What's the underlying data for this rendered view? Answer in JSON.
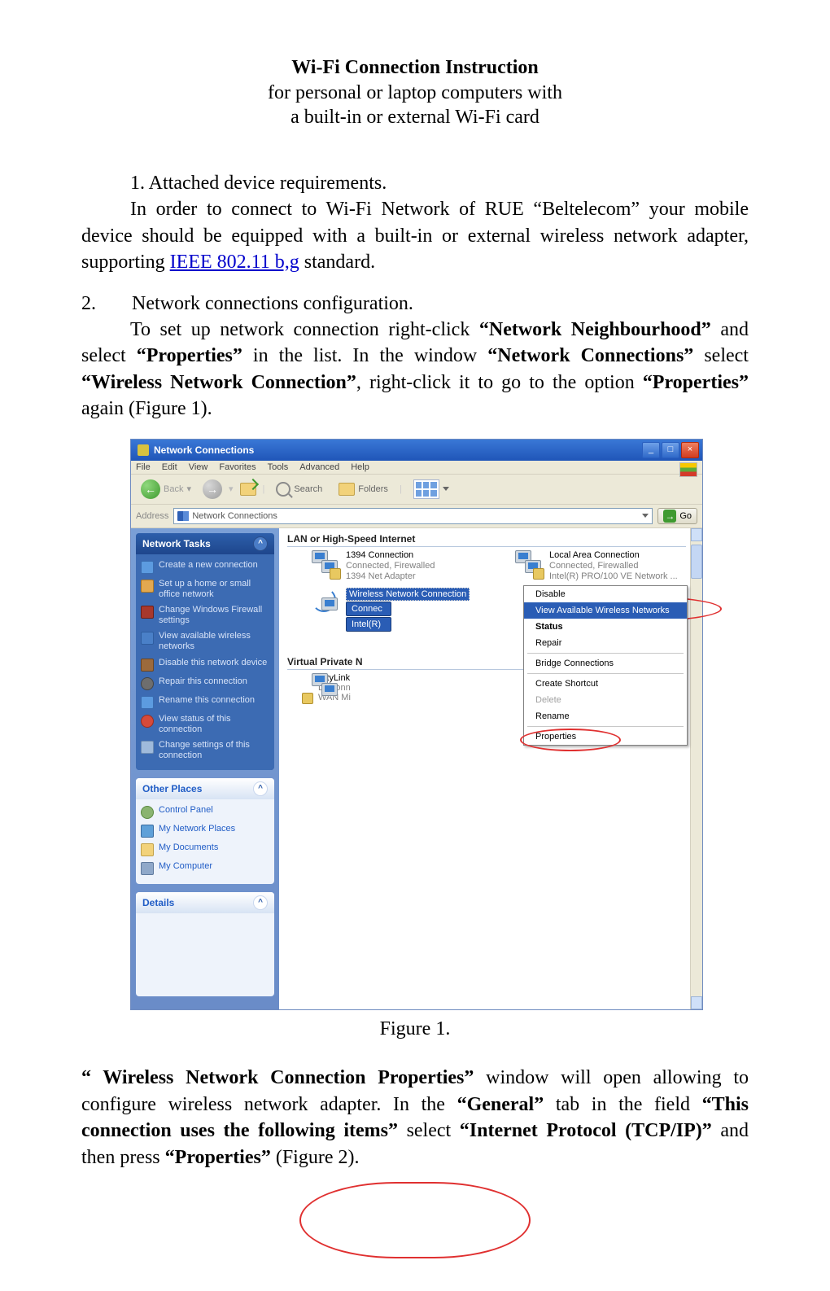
{
  "doc": {
    "title": "Wi-Fi Connection Instruction",
    "subtitle_line1": "for personal or laptop computers with",
    "subtitle_line2": "a built-in or external Wi-Fi card",
    "sec1_num": "1.  Attached device requirements.",
    "sec1_p_l1": "In order to connect to Wi-Fi Network of RUE “Beltelecom” your mobile device should be equipped with a built-in or external wireless network adapter, supporting ",
    "ieee": "IEEE 802.11 b,g",
    "sec1_p_l2": " standard.",
    "sec2_num": "2.",
    "sec2_title": "Network connections configuration.",
    "sec2_p1_a": "To set up network connection right-click ",
    "sec2_p1_b": "“Network Neighbourhood”",
    "sec2_p1_c": " and select ",
    "sec2_p1_d": "“Properties”",
    "sec2_p1_e": " in the list. In the window ",
    "sec2_p1_f": "“Network Connections”",
    "sec2_p1_g": " select ",
    "sec2_p1_h": "“Wireless Network Connection”",
    "sec2_p1_i": ", right-click it to go to the option ",
    "sec2_p1_j": "“Properties”",
    "sec2_p1_k": " again (Figure 1).",
    "fig1": "Figure 1.",
    "para2_a": " “ Wireless Network Connection Properties”",
    "para2_b": " window will open allowing to configure wireless network adapter. In the ",
    "para2_c": "“General”",
    "para2_d": " tab in the field ",
    "para2_e": "“This connection uses the following items”",
    "para2_f": " select ",
    "para2_g": "“Internet Protocol (TCP/IP)”",
    "para2_h": " and then press ",
    "para2_i": "“Properties”",
    "para2_j": " (Figure 2)."
  },
  "win": {
    "title": "Network Connections",
    "menu": [
      "File",
      "Edit",
      "View",
      "Favorites",
      "Tools",
      "Advanced",
      "Help"
    ],
    "back": "Back",
    "search": "Search",
    "folders": "Folders",
    "address_label": "Address",
    "address_value": "Network Connections",
    "go": "Go",
    "group_lan": "LAN or High-Speed Internet",
    "group_vpn": "Virtual Private N",
    "tasks_header": "Network Tasks",
    "tasks": [
      "Create a new connection",
      "Set up a home or small office network",
      "Change Windows Firewall settings",
      "View available wireless networks",
      "Disable this network device",
      "Repair this connection",
      "Rename this connection",
      "View status of this connection",
      "Change settings of this connection"
    ],
    "other_header": "Other Places",
    "other": [
      "Control Panel",
      "My Network Places",
      "My Documents",
      "My Computer"
    ],
    "details_header": "Details",
    "conn_1394_name": "1394 Connection",
    "conn_1394_stat": "Connected, Firewalled",
    "conn_1394_adpt": "1394 Net Adapter",
    "conn_lan_name": "Local Area Connection",
    "conn_lan_stat": "Connected, Firewalled",
    "conn_lan_adpt": "Intel(R) PRO/100 VE Network ...",
    "conn_wl_name": "Wireless Network Connection",
    "conn_wl_stat": "Connec",
    "conn_wl_adpt": "Intel(R)",
    "vpn_name": "CityLink",
    "vpn_stat": "Disconn",
    "vpn_adpt": "WAN Mi",
    "ctx": {
      "disable": "Disable",
      "view": "View Available Wireless Networks",
      "status": "Status",
      "repair": "Repair",
      "bridge": "Bridge Connections",
      "shortcut": "Create Shortcut",
      "delete": "Delete",
      "rename": "Rename",
      "properties": "Properties"
    },
    "btn_min": "_",
    "btn_max": "□",
    "btn_close": "×"
  }
}
